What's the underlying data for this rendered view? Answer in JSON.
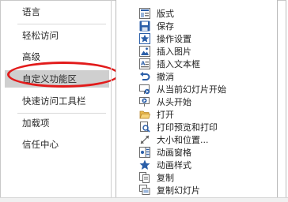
{
  "nav": {
    "items": [
      {
        "label": "语言"
      },
      {
        "label": "轻松访问"
      },
      {
        "label": "高级"
      },
      {
        "label": "自定义功能区",
        "selected": true
      },
      {
        "label": "快速访问工具栏"
      },
      {
        "label": "加载项"
      },
      {
        "label": "信任中心"
      }
    ]
  },
  "commands": [
    {
      "label": "版式",
      "icon": "layout-icon"
    },
    {
      "label": "保存",
      "icon": "save-icon"
    },
    {
      "label": "操作设置",
      "icon": "action-settings-icon"
    },
    {
      "label": "插入图片",
      "icon": "insert-picture-icon"
    },
    {
      "label": "插入文本框",
      "icon": "insert-textbox-icon"
    },
    {
      "label": "撤消",
      "icon": "undo-icon"
    },
    {
      "label": "从当前幻灯片开始",
      "icon": "from-current-slide-icon"
    },
    {
      "label": "从头开始",
      "icon": "from-beginning-icon"
    },
    {
      "label": "打开",
      "icon": "open-folder-icon"
    },
    {
      "label": "打印预览和打印",
      "icon": "print-preview-icon"
    },
    {
      "label": "大小和位置...",
      "icon": "size-position-icon"
    },
    {
      "label": "动画窗格",
      "icon": "animation-pane-icon"
    },
    {
      "label": "动画样式",
      "icon": "animation-styles-icon"
    },
    {
      "label": "复制",
      "icon": "copy-icon"
    },
    {
      "label": "复制幻灯片",
      "icon": "duplicate-slide-icon"
    }
  ],
  "colors": {
    "highlight": "#e21b1b",
    "selected_bg": "#cfcfcf",
    "icon_blue": "#2a5ea8"
  }
}
